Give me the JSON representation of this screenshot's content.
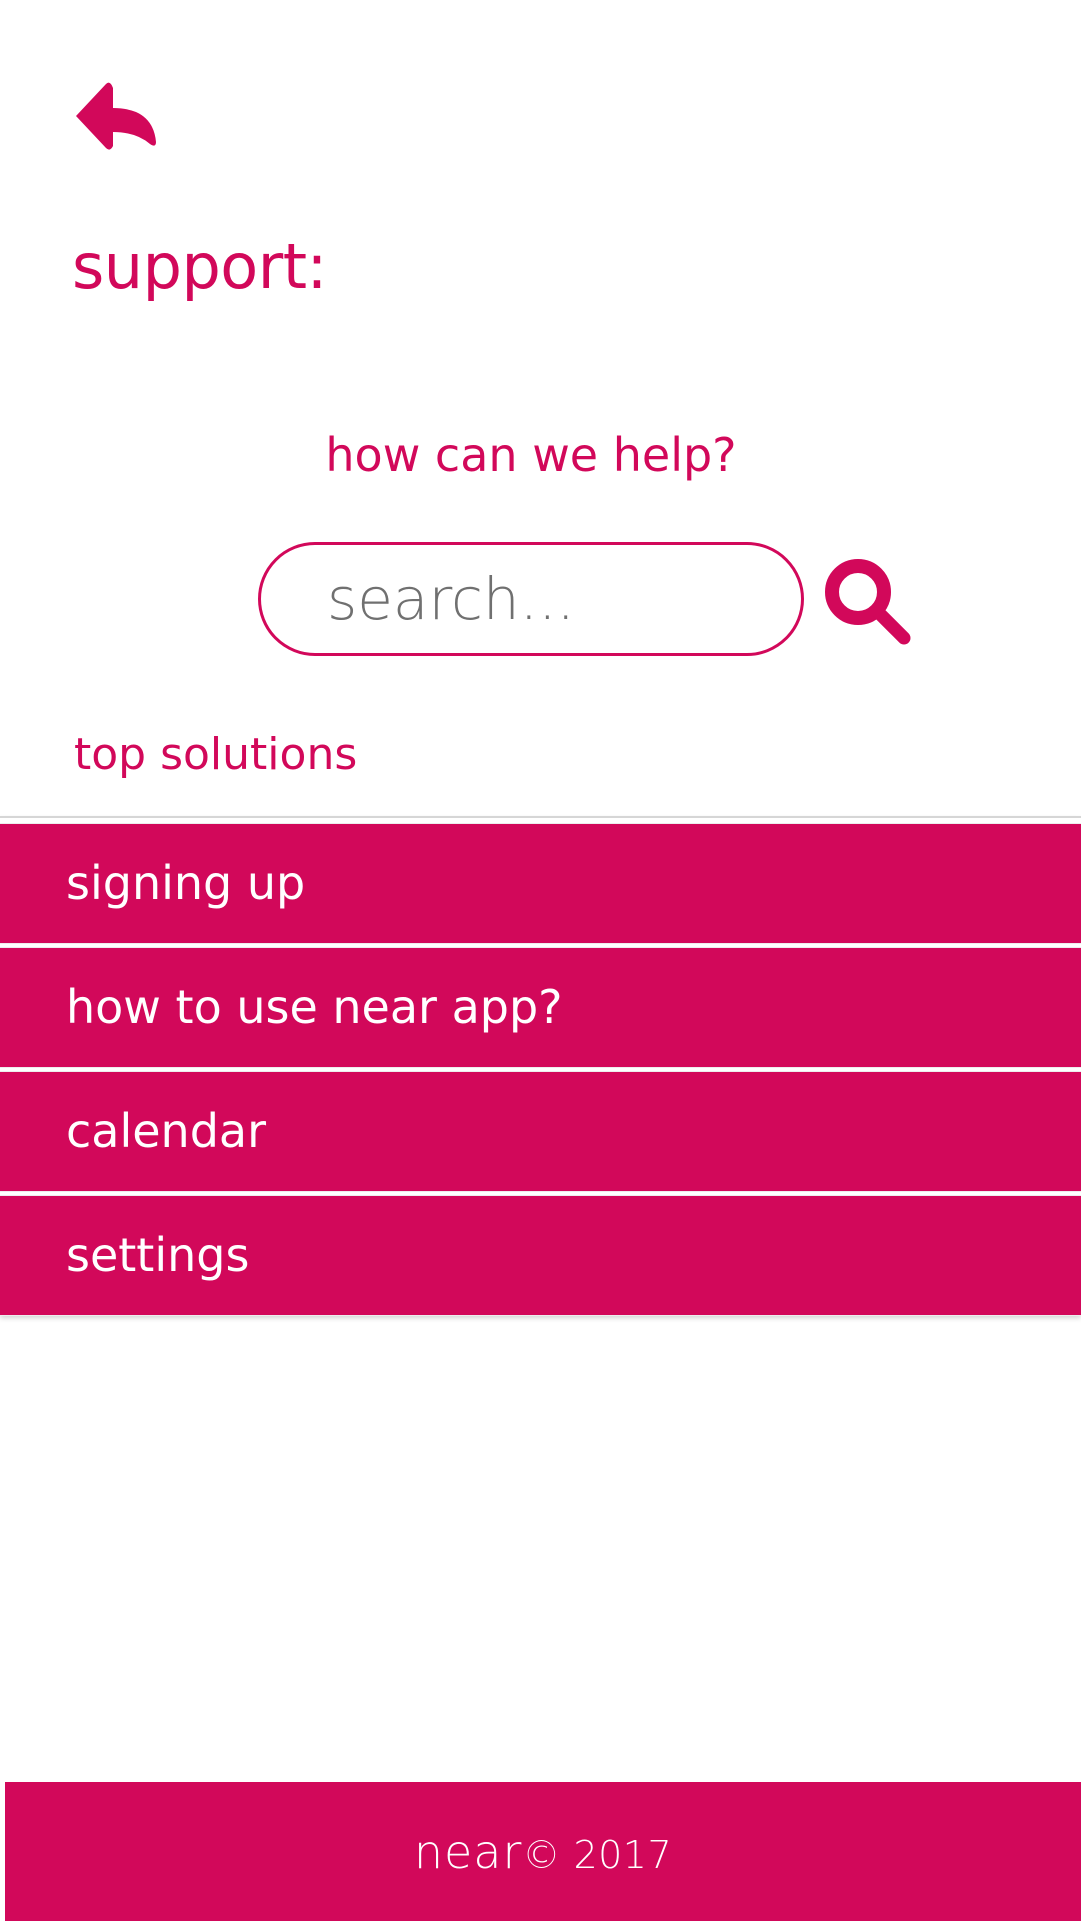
{
  "header": {
    "back_icon": "back-arrow-icon",
    "title": "support:"
  },
  "help": {
    "heading": "how can we help?"
  },
  "search": {
    "placeholder": "search...",
    "value": "",
    "icon": "search-icon"
  },
  "solutions": {
    "label": "top solutions",
    "items": [
      {
        "label": "signing up"
      },
      {
        "label": "how to use near app?"
      },
      {
        "label": "calendar"
      },
      {
        "label": "settings"
      }
    ]
  },
  "footer": {
    "brand": "near",
    "copyright": "© 2017"
  },
  "colors": {
    "accent": "#d2085a",
    "background": "#ffffff",
    "text_on_accent": "#ffffff",
    "placeholder": "#707070"
  }
}
